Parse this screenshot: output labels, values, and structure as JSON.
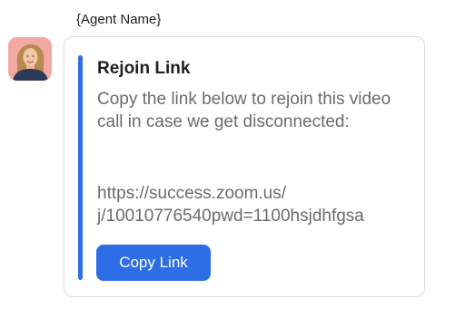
{
  "message": {
    "sender_name": "{Agent Name}",
    "avatar_icon": "agent-avatar-photo",
    "card": {
      "title": "Rejoin Link",
      "body": "Copy the link below to rejoin this video call in case we get disconnected:",
      "link_line1": "https://success.zoom.us/",
      "link_line2": "j/10010776540pwd=1100hsjdhfgsa",
      "button_label": "Copy Link"
    }
  },
  "colors": {
    "accent": "#2e6ee6",
    "button": "#2d6ee6",
    "body_text": "#6b6b6f",
    "card_border": "#dcdcdf"
  }
}
